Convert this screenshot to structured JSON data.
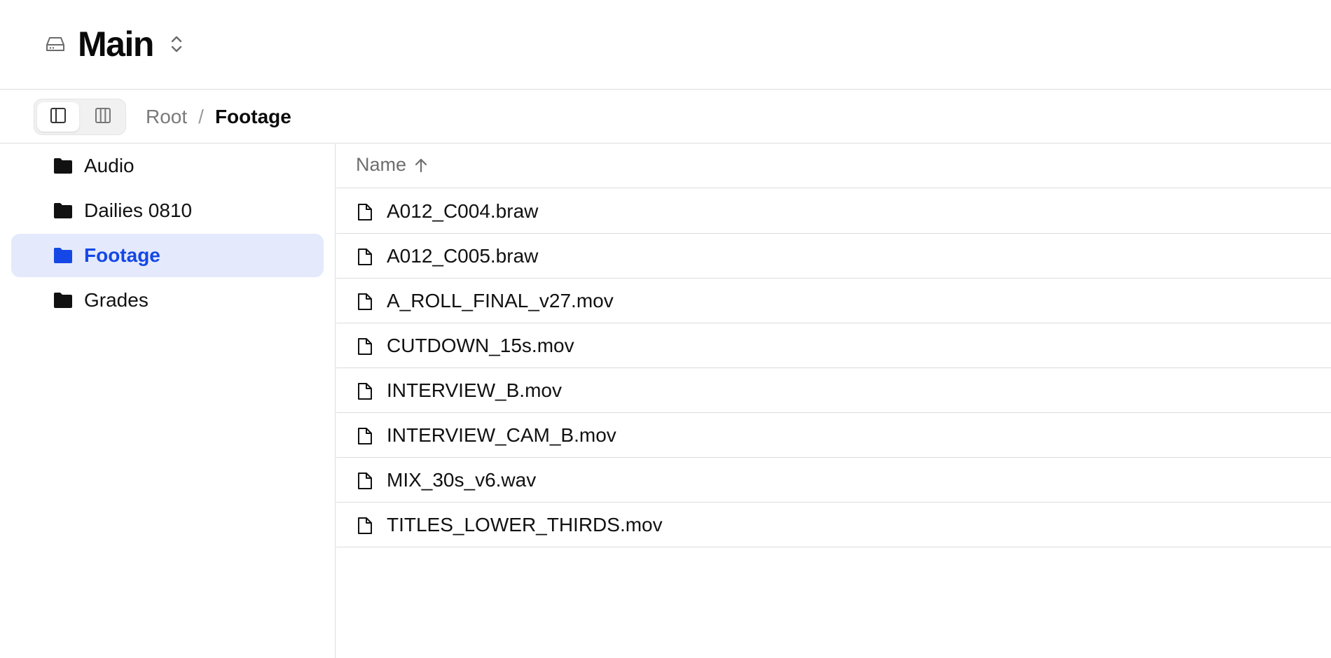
{
  "header": {
    "title": "Main",
    "drive_icon": "hard-drive-icon",
    "switcher_icon": "chevron-up-down-icon"
  },
  "toolbar": {
    "view_modes": [
      {
        "icon": "sidebar-view-icon",
        "active": true
      },
      {
        "icon": "columns-view-icon",
        "active": false
      }
    ],
    "breadcrumb": {
      "root": "Root",
      "separator": "/",
      "current": "Footage"
    }
  },
  "sidebar": {
    "folders": [
      {
        "label": "Audio",
        "selected": false
      },
      {
        "label": "Dailies 0810",
        "selected": false
      },
      {
        "label": "Footage",
        "selected": true
      },
      {
        "label": "Grades",
        "selected": false
      }
    ]
  },
  "filelist": {
    "column_name": "Name",
    "sort_direction": "ascending",
    "files": [
      {
        "name": "A012_C004.braw"
      },
      {
        "name": "A012_C005.braw"
      },
      {
        "name": "A_ROLL_FINAL_v27.mov"
      },
      {
        "name": "CUTDOWN_15s.mov"
      },
      {
        "name": "INTERVIEW_B.mov"
      },
      {
        "name": "INTERVIEW_CAM_B.mov"
      },
      {
        "name": "MIX_30s_v6.wav"
      },
      {
        "name": "TITLES_LOWER_THIRDS.mov"
      }
    ]
  },
  "colors": {
    "accent": "#1447e6",
    "selected_bg": "#e4eafc",
    "border": "#dcdcdc"
  }
}
